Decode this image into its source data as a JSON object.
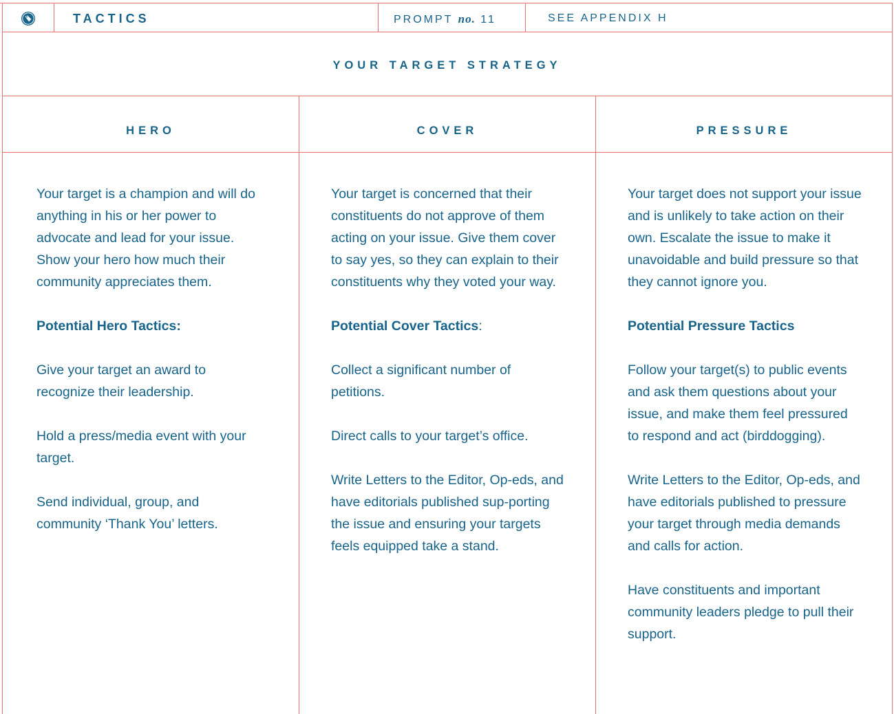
{
  "colors": {
    "accent_line": "#e8726b",
    "text": "#17638a"
  },
  "header": {
    "logo_icon": "tag-badge-icon",
    "section": "TACTICS",
    "prompt_label": "PROMPT",
    "prompt_no": "no.",
    "prompt_number": "11",
    "appendix": "SEE APPENDIX H"
  },
  "title": "YOUR TARGET STRATEGY",
  "columns": [
    {
      "heading": "HERO",
      "intro": "Your target is a champion and will do anything in his or her power to advocate and lead for your issue. Show your hero how much their community appreciates them.",
      "tactics_heading": "Potential Hero Tactics:",
      "tactics_suffix": "",
      "tactics": [
        "Give your target an award to recognize their leadership.",
        "Hold a press/media event with your target.",
        "Send individual, group, and community ‘Thank You’ letters."
      ]
    },
    {
      "heading": "COVER",
      "intro": "Your target is concerned that their constituents do not approve of them acting on your issue. Give them cover to say yes, so they can explain to their constituents why they voted your way.",
      "tactics_heading": "Potential Cover Tactics",
      "tactics_suffix": ":",
      "tactics": [
        "Collect a significant number of petitions.",
        "Direct calls to your target’s office.",
        "Write Letters to the Editor, Op-eds, and have editorials published sup-porting the issue and ensuring your targets feels equipped take a stand."
      ]
    },
    {
      "heading": "PRESSURE",
      "intro": "Your target does not support your issue and is unlikely to take action on their own. Escalate the issue to make it unavoidable and build pressure so that they cannot ignore you.",
      "tactics_heading": "Potential Pressure Tactics",
      "tactics_suffix": "",
      "tactics": [
        "Follow your target(s) to public events and ask them questions about your issue, and make them feel pressured to respond and act (birddogging).",
        "Write Letters to the Editor, Op-eds, and have editorials published to pressure your target through media demands and calls for action.",
        "Have constituents and important community leaders pledge to pull their support."
      ]
    }
  ]
}
